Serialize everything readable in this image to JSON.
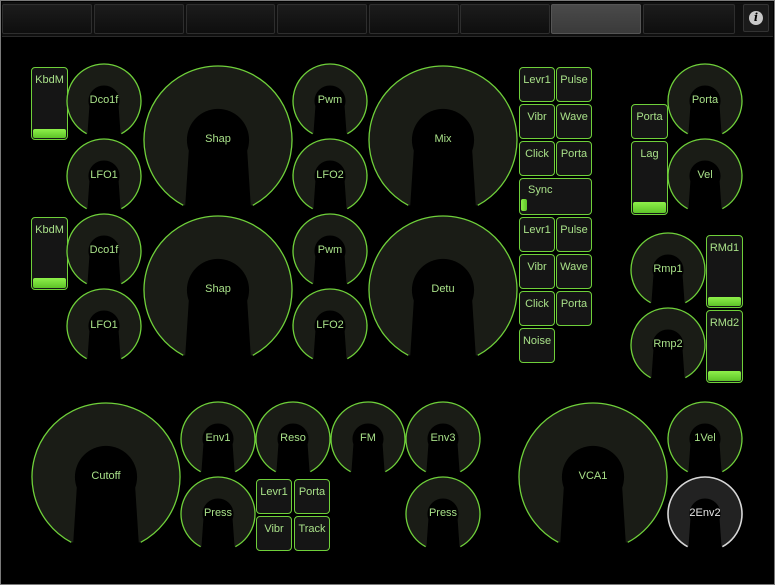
{
  "colors": {
    "accent": "#6fd03a",
    "label": "#a8e088",
    "knob_body": "#1a1c16",
    "selected_ring": "#d8d8d8",
    "background": "#000000"
  },
  "tabs": {
    "count": 8,
    "active_index": 6
  },
  "toolbar": {
    "info_icon": "info-icon",
    "info_glyph": "i"
  },
  "knobs": {
    "osc1_dco1f": "Dco1f",
    "osc1_lfo1": "LFO1",
    "osc1_shap": "Shap",
    "osc1_pwm": "Pwm",
    "osc1_lfo2": "LFO2",
    "mix": "Mix",
    "osc2_dco1f": "Dco1f",
    "osc2_lfo1": "LFO1",
    "osc2_shap": "Shap",
    "osc2_pwm": "Pwm",
    "osc2_lfo2": "LFO2",
    "detu": "Detu",
    "porta": "Porta",
    "vel": "Vel",
    "rmp1": "Rmp1",
    "rmp2": "Rmp2",
    "cutoff": "Cutoff",
    "env1": "Env1",
    "reso": "Reso",
    "fm": "FM",
    "env3": "Env3",
    "filter_press": "Press",
    "env3_press": "Press",
    "vca1": "VCA1",
    "vel1": "1Vel",
    "env2": "2Env2"
  },
  "buttons": {
    "osc1_levr1": "Levr1",
    "osc1_pulse": "Pulse",
    "osc1_vibr": "Vibr",
    "osc1_wave": "Wave",
    "osc1_click": "Click",
    "osc1_porta": "Porta",
    "osc2_levr1": "Levr1",
    "osc2_pulse": "Pulse",
    "osc2_vibr": "Vibr",
    "osc2_wave": "Wave",
    "osc2_click": "Click",
    "osc2_porta": "Porta",
    "noise": "Noise",
    "porta_mode": "Porta",
    "filter_levr1": "Levr1",
    "filter_porta": "Porta",
    "filter_vibr": "Vibr",
    "filter_track": "Track"
  },
  "sliders": {
    "kbdm1": {
      "label": "KbdM",
      "level": 0.13
    },
    "kbdm2": {
      "label": "KbdM",
      "level": 0.14
    },
    "lag": {
      "label": "Lag",
      "level": 0.15
    },
    "rmd1": {
      "label": "RMd1",
      "level": 0.13
    },
    "rmd2": {
      "label": "RMd2",
      "level": 0.14
    },
    "sync": {
      "label": "Sync",
      "level": 0.05
    }
  }
}
